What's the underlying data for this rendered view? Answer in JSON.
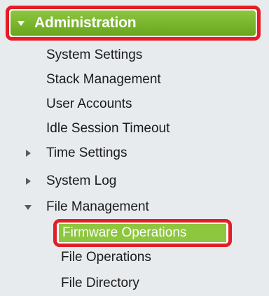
{
  "section": {
    "title": "Administration",
    "expanded": true
  },
  "menu": {
    "system_settings": "System Settings",
    "stack_management": "Stack Management",
    "user_accounts": "User Accounts",
    "idle_session_timeout": "Idle Session Timeout",
    "time_settings": "Time Settings",
    "system_log": "System Log",
    "file_management": "File Management",
    "firmware_operations": "Firmware Operations",
    "file_operations": "File Operations",
    "file_directory": "File Directory"
  },
  "colors": {
    "header_green": "#8dc63f",
    "highlight_red": "#e31e24",
    "panel_bg": "#e8ebee",
    "text": "#1a1a1a"
  }
}
